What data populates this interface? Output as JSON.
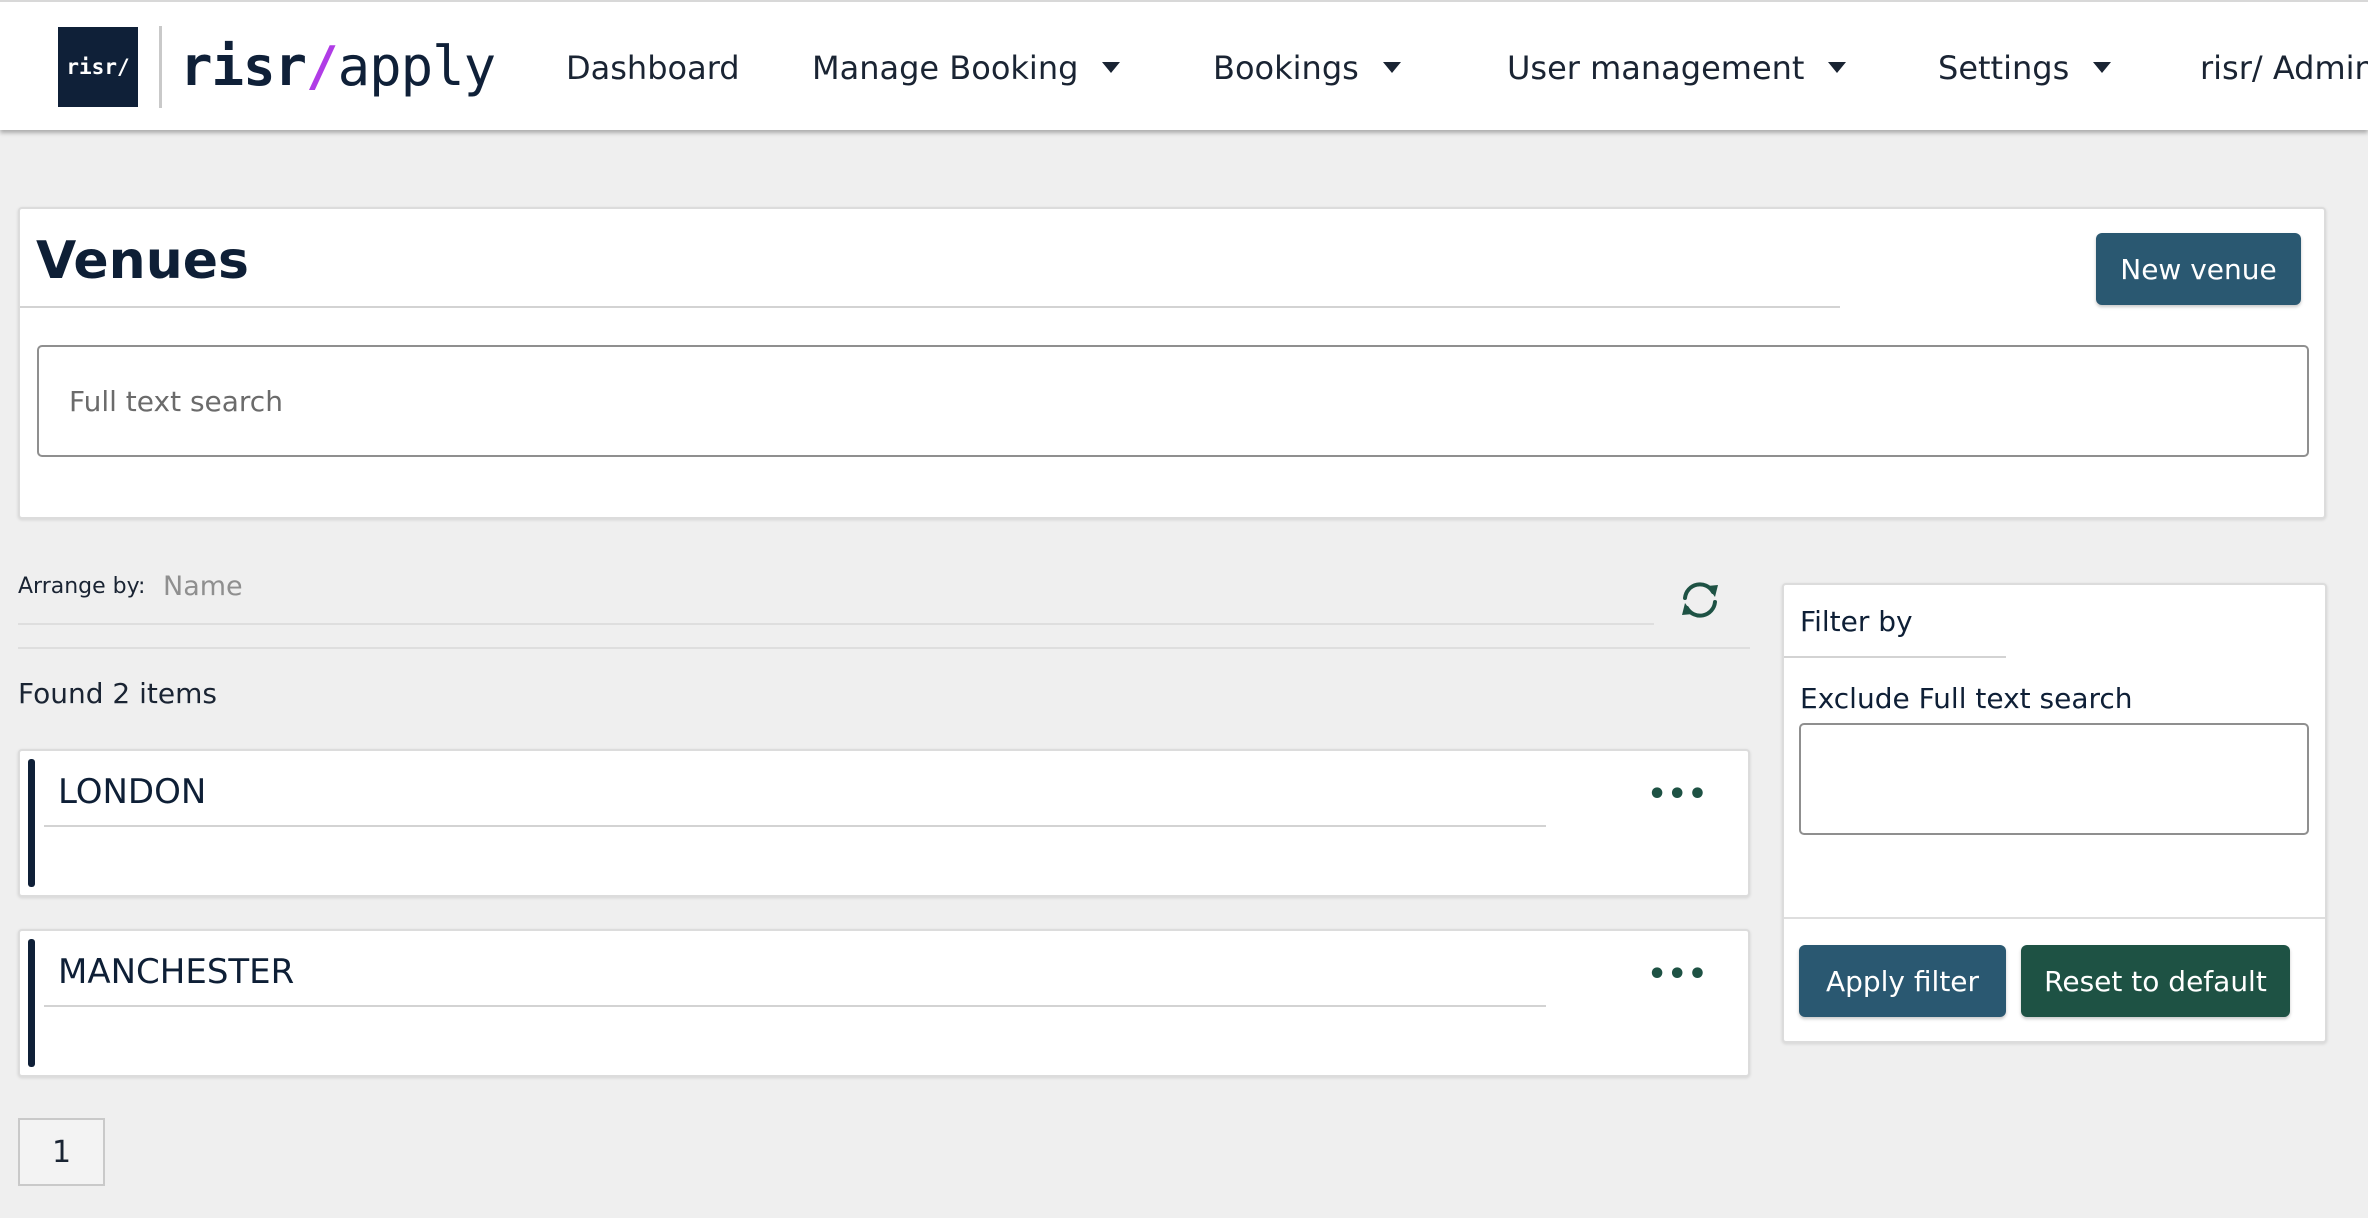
{
  "nav": {
    "logo_box": "risr/",
    "logo_brand": "risr",
    "logo_slash": "/",
    "logo_product": "apply",
    "items": [
      {
        "label": "Dashboard"
      },
      {
        "label": "Manage Booking"
      },
      {
        "label": "Bookings"
      },
      {
        "label": "User management"
      },
      {
        "label": "Settings"
      },
      {
        "label": "risr/ Admin"
      }
    ]
  },
  "header": {
    "title": "Venues",
    "new_button": "New venue",
    "search_placeholder": "Full text search",
    "search_value": ""
  },
  "arrange": {
    "label": "Arrange by:",
    "value": "Name",
    "refresh_icon": "refresh-icon"
  },
  "results": {
    "found_text": "Found 2 items",
    "venues": [
      {
        "name": "LONDON",
        "menu": "•••"
      },
      {
        "name": "MANCHESTER",
        "menu": "•••"
      }
    ]
  },
  "filter": {
    "title": "Filter by",
    "exclude_label": "Exclude Full text search",
    "exclude_value": "",
    "apply_button": "Apply filter",
    "reset_button": "Reset to default"
  },
  "pagination": {
    "current_page": "1"
  },
  "colors": {
    "navy": "#0f2038",
    "button_blue": "#2a5871",
    "button_green": "#1e5244",
    "accent_purple": "#b03ce6",
    "background": "#efefef"
  }
}
